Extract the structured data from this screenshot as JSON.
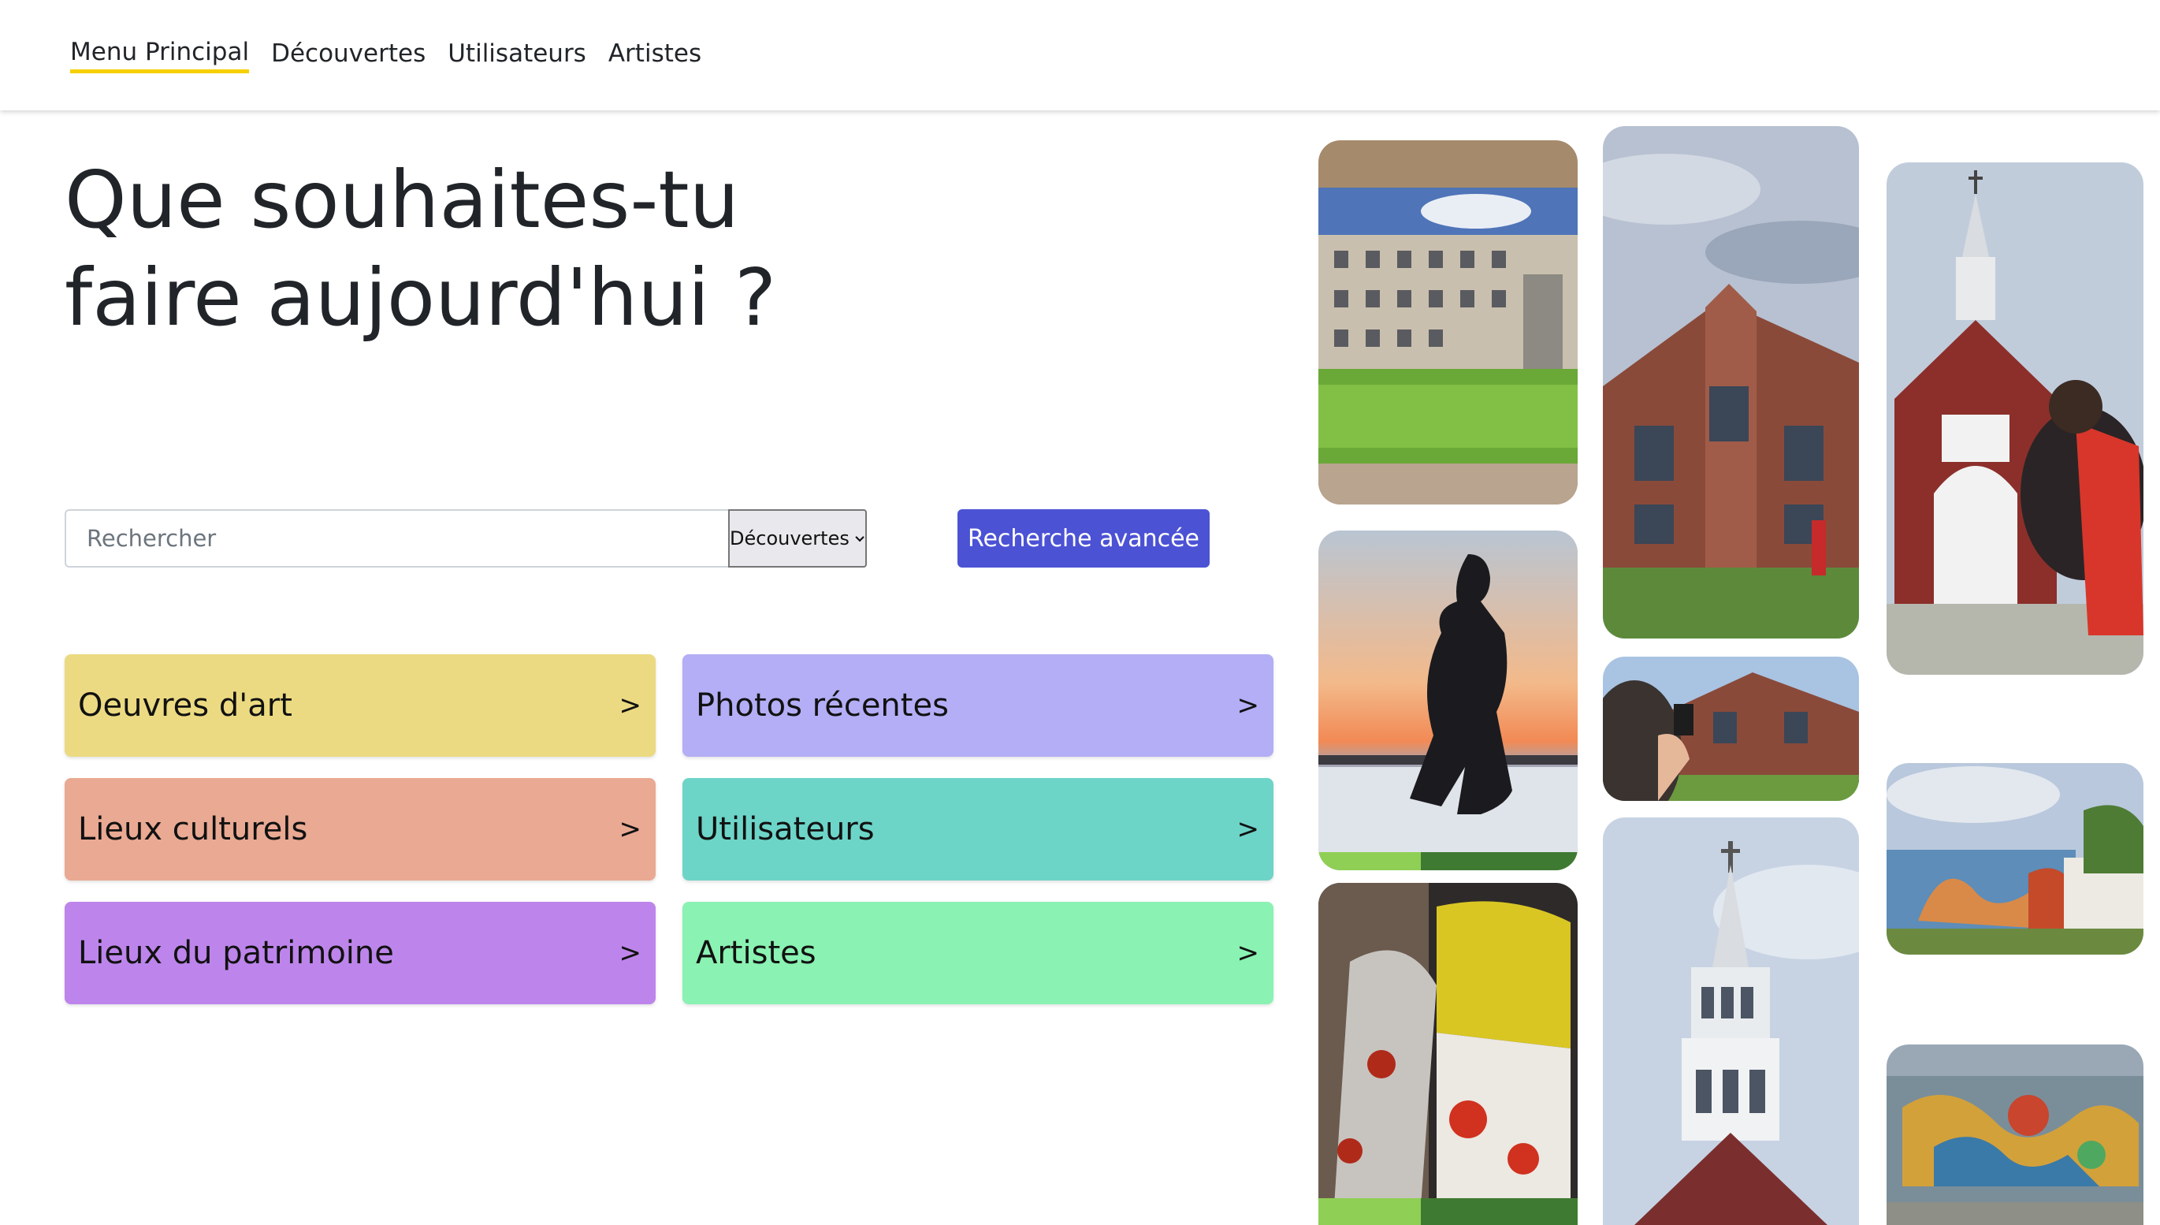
{
  "nav": {
    "items": [
      {
        "label": "Menu Principal",
        "active": true
      },
      {
        "label": "Découvertes",
        "active": false
      },
      {
        "label": "Utilisateurs",
        "active": false
      },
      {
        "label": "Artistes",
        "active": false
      }
    ]
  },
  "hero": {
    "line1": "Que souhaites-tu",
    "line2": "faire aujourd'hui ?"
  },
  "search": {
    "placeholder": "Rechercher",
    "category_value": "Découvertes",
    "advanced_label": "Recherche avancée"
  },
  "tiles": [
    {
      "label": "Oeuvres d'art",
      "arrow": ">",
      "color": "#ecda82"
    },
    {
      "label": "Photos récentes",
      "arrow": ">",
      "color": "#b3aef5"
    },
    {
      "label": "Lieux culturels",
      "arrow": ">",
      "color": "#e9a993"
    },
    {
      "label": "Utilisateurs",
      "arrow": ">",
      "color": "#6dd4c8"
    },
    {
      "label": "Lieux du patrimoine",
      "arrow": ">",
      "color": "#bd85eb"
    },
    {
      "label": "Artistes",
      "arrow": ">",
      "color": "#8af2b2"
    }
  ],
  "colors": {
    "accent": "#4b52d4",
    "nav_underline": "#f6d000"
  },
  "gallery": [
    {
      "subject": "modern building with glass facade and lawn"
    },
    {
      "subject": "statue silhouette at sunset by the river"
    },
    {
      "subject": "stained glass artwork"
    },
    {
      "subject": "Bibliothèque de Saint-Côme brick building"
    },
    {
      "subject": "person photographing library"
    },
    {
      "subject": "white church steeple"
    },
    {
      "subject": "red brick church"
    },
    {
      "subject": "mural on building wall"
    },
    {
      "subject": "colorful mural"
    }
  ]
}
